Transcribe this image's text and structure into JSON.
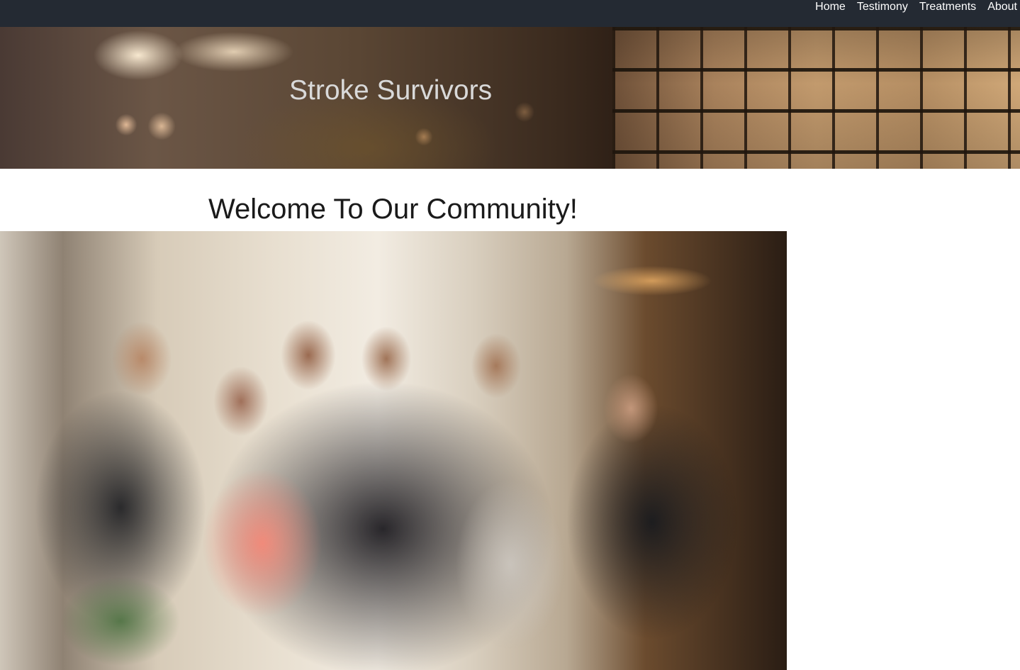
{
  "nav": {
    "links": [
      {
        "label": "Home"
      },
      {
        "label": "Testimony"
      },
      {
        "label": "Treatments"
      },
      {
        "label": "About"
      }
    ]
  },
  "hero": {
    "title": "Stroke Survivors"
  },
  "main": {
    "heading": "Welcome To Our Community!",
    "photo_alt": "community-group-photo"
  },
  "colors": {
    "navbar_bg": "#242a33",
    "nav_text": "#ffffff",
    "hero_title": "#d9d9d9",
    "heading_text": "#1a1a1a"
  }
}
